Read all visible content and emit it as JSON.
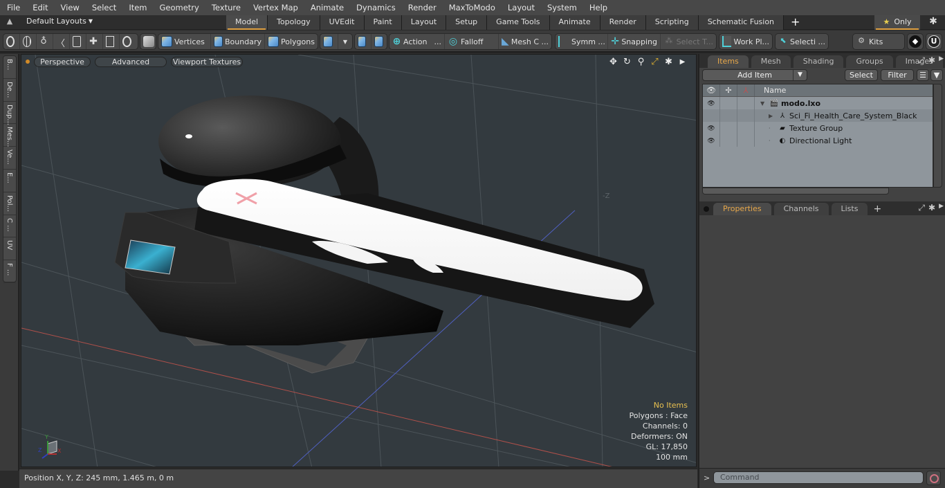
{
  "menu": [
    "File",
    "Edit",
    "View",
    "Select",
    "Item",
    "Geometry",
    "Texture",
    "Vertex Map",
    "Animate",
    "Dynamics",
    "Render",
    "MaxToModo",
    "Layout",
    "System",
    "Help"
  ],
  "layoutbar": {
    "layout_selector": "Default Layouts",
    "tabs": [
      "Model",
      "Topology",
      "UVEdit",
      "Paint",
      "Layout",
      "Setup",
      "Game Tools",
      "Animate",
      "Render",
      "Scripting",
      "Schematic Fusion"
    ],
    "active_tab": "Model",
    "add_tab": "+",
    "only_label": "Only"
  },
  "toolbar": {
    "vertices": "Vertices",
    "boundary": "Boundary",
    "polygons": "Polygons",
    "action": "Action",
    "action_more": "...",
    "falloff": "Falloff",
    "mesh_c": "Mesh C ...",
    "symm": "Symm ...",
    "snapping": "Snapping",
    "select_t": "Select T...",
    "work_pl": "Work Pl...",
    "selecti": "Selecti ...",
    "kits": "Kits"
  },
  "left_strip": [
    "B...",
    "De...",
    "Dup...",
    "Mes...",
    "Ve...",
    "E...",
    "Pol...",
    "C ...",
    "UV",
    "F ..."
  ],
  "viewport": {
    "view_mode": "Perspective",
    "shading": "Advanced",
    "textures": "Viewport Textures",
    "info": {
      "selection": "No Items",
      "polygons": "Polygons : Face",
      "channels": "Channels: 0",
      "deformers": "Deformers: ON",
      "gl": "GL: 17,850",
      "scale": "100 mm"
    },
    "axis_labels": {
      "x": "X",
      "y": "Y",
      "z": "Z",
      "neg_z": "-Z"
    }
  },
  "status": {
    "position": "Position X, Y, Z:   245 mm, 1.465 m, 0 m"
  },
  "items_panel": {
    "tabs": [
      "Items",
      "Mesh ...",
      "Shading",
      "Groups",
      "Images"
    ],
    "active_tab": "Items",
    "add_item": "Add Item",
    "select": "Select",
    "filter": "Filter",
    "name_header": "Name",
    "tree": [
      {
        "name": "modo.lxo",
        "bold": true,
        "eye": true,
        "expander": "▼",
        "indent": 0
      },
      {
        "name": "Sci_Fi_Health_Care_System_Black",
        "bold": false,
        "eye": false,
        "expander": "▶",
        "indent": 1
      },
      {
        "name": "Texture Group",
        "bold": false,
        "eye": true,
        "expander": "",
        "indent": 1
      },
      {
        "name": "Directional Light",
        "bold": false,
        "eye": true,
        "expander": "",
        "indent": 1
      }
    ]
  },
  "properties_panel": {
    "tabs": [
      "Properties",
      "Channels",
      "Lists"
    ],
    "active_tab": "Properties"
  },
  "command": {
    "prompt": ">",
    "placeholder": "Command"
  }
}
